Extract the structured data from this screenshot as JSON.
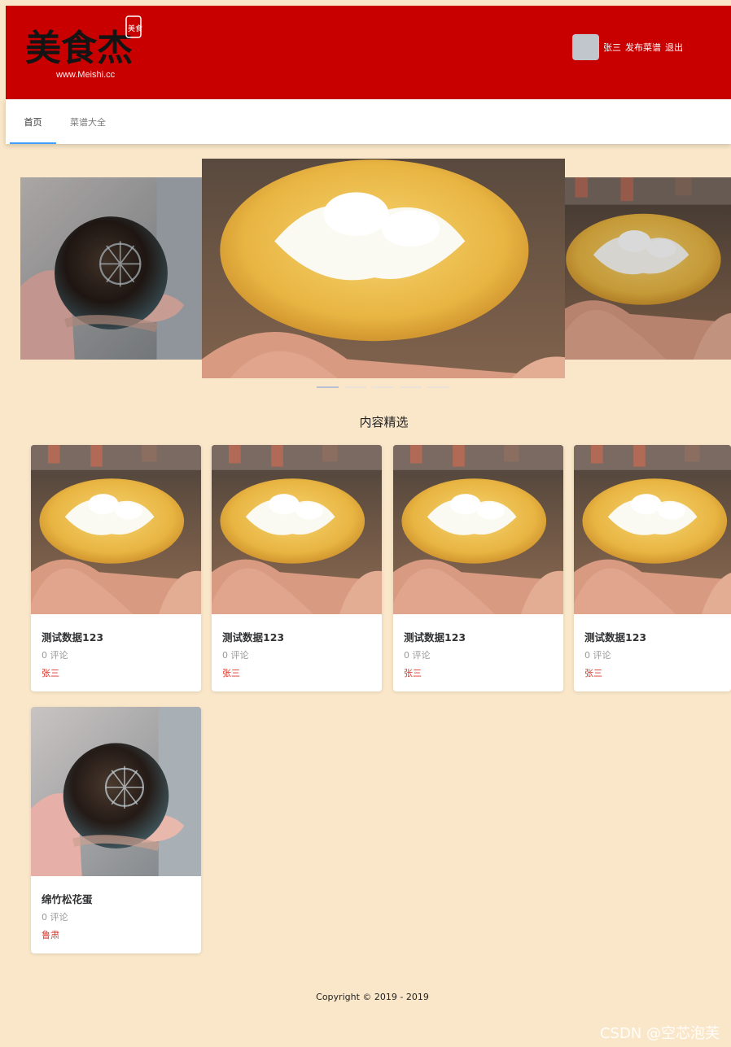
{
  "header": {
    "logo_text": "美食杰",
    "logo_url_text": "www.Meishi.cc",
    "logo_seal_text": "美食",
    "username": "张三",
    "publish_label": "发布菜谱",
    "logout_label": "退出"
  },
  "nav": {
    "tabs": [
      {
        "label": "首页",
        "active": true
      },
      {
        "label": "菜谱大全",
        "active": false
      }
    ]
  },
  "carousel": {
    "slides": [
      {
        "image": "songhuadan-egg-photo"
      },
      {
        "image": "cream-puff-photo"
      },
      {
        "image": "cream-puff-photo"
      }
    ],
    "indicator_count": 5,
    "active_index": 0
  },
  "section": {
    "title": "内容精选"
  },
  "cards": [
    {
      "title": "测试数据123",
      "comments": "0 评论",
      "author": "张三",
      "image": "cream-puff-photo"
    },
    {
      "title": "测试数据123",
      "comments": "0 评论",
      "author": "张三",
      "image": "cream-puff-photo"
    },
    {
      "title": "测试数据123",
      "comments": "0 评论",
      "author": "张三",
      "image": "cream-puff-photo"
    },
    {
      "title": "测试数据123",
      "comments": "0 评论",
      "author": "张三",
      "image": "cream-puff-photo"
    },
    {
      "title": "绵竹松花蛋",
      "comments": "0 评论",
      "author": "鲁肃",
      "image": "songhuadan-egg-photo"
    }
  ],
  "footer": {
    "copyright": "Copyright © 2019 - 2019"
  },
  "watermark": "CSDN @空芯泡芙",
  "colors": {
    "header_bg": "#c90000",
    "page_bg": "#fae7c9",
    "author_red": "#d9372b",
    "tab_underline": "#409eff"
  }
}
